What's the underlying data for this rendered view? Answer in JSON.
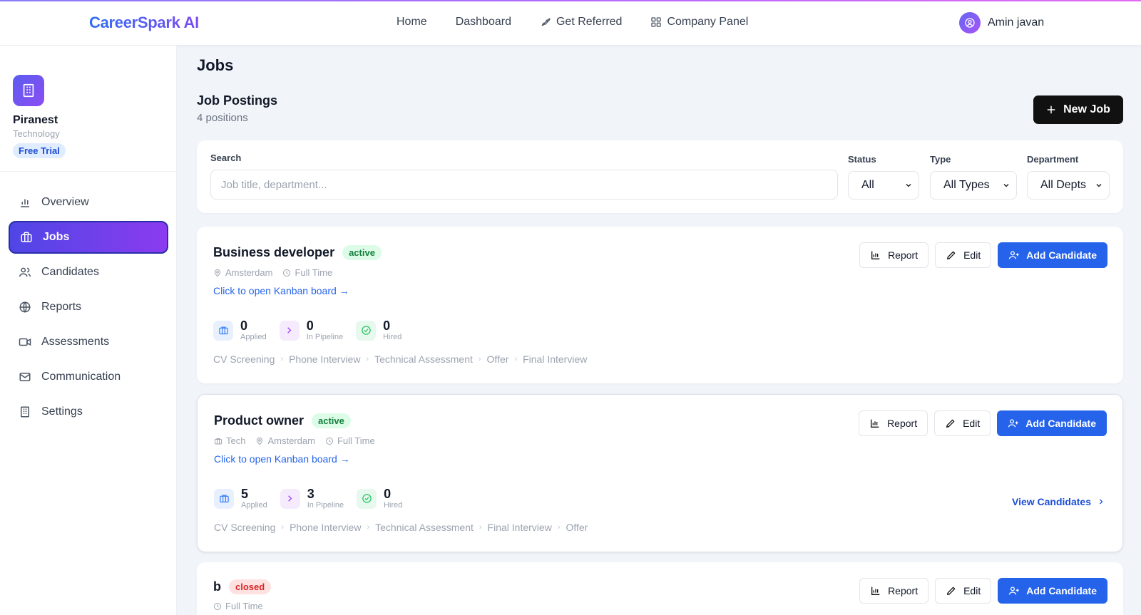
{
  "brand": {
    "name": "CareerSpark AI"
  },
  "nav": {
    "home": "Home",
    "dashboard": "Dashboard",
    "get_referred": "Get Referred",
    "company_panel": "Company Panel"
  },
  "user": {
    "name": "Amin javan"
  },
  "company": {
    "name": "Piranest",
    "industry": "Technology",
    "plan": "Free Trial"
  },
  "sidebar": {
    "items": [
      {
        "label": "Overview",
        "icon": "bar-chart-icon"
      },
      {
        "label": "Jobs",
        "icon": "briefcase-icon",
        "active": true
      },
      {
        "label": "Candidates",
        "icon": "users-icon"
      },
      {
        "label": "Reports",
        "icon": "globe-icon"
      },
      {
        "label": "Assessments",
        "icon": "video-icon"
      },
      {
        "label": "Communication",
        "icon": "mail-icon"
      },
      {
        "label": "Settings",
        "icon": "building-icon"
      }
    ]
  },
  "page": {
    "title": "Jobs",
    "section_title": "Job Postings",
    "section_sub": "4 positions",
    "new_job_label": "New Job"
  },
  "filters": {
    "search_label": "Search",
    "search_placeholder": "Job title, department...",
    "search_value": "",
    "status_label": "Status",
    "status_value": "All",
    "type_label": "Type",
    "type_value": "All Types",
    "department_label": "Department",
    "department_value": "All Depts"
  },
  "actions": {
    "report": "Report",
    "edit": "Edit",
    "add_candidate": "Add Candidate",
    "kanban": "Click to open Kanban board →",
    "view_candidates": "View Candidates"
  },
  "stat_labels": {
    "applied": "Applied",
    "pipeline": "In Pipeline",
    "hired": "Hired"
  },
  "jobs": [
    {
      "title": "Business developer",
      "status": "active",
      "department": "",
      "location": "Amsterdam",
      "type": "Full Time",
      "applied": "0",
      "pipeline": "0",
      "hired": "0",
      "stages": [
        "CV Screening",
        "Phone Interview",
        "Technical Assessment",
        "Offer",
        "Final Interview"
      ]
    },
    {
      "title": "Product owner",
      "status": "active",
      "department": "Tech",
      "location": "Amsterdam",
      "type": "Full Time",
      "applied": "5",
      "pipeline": "3",
      "hired": "0",
      "stages": [
        "CV Screening",
        "Phone Interview",
        "Technical Assessment",
        "Final Interview",
        "Offer"
      ]
    },
    {
      "title": "b",
      "status": "closed",
      "department": "",
      "location": "",
      "type": "Full Time"
    }
  ],
  "colors": {
    "primary": "#2563eb",
    "accent_start": "#4f46e5",
    "accent_end": "#8b3bf0",
    "active_green": "#15803d",
    "closed_red": "#dc2626"
  }
}
